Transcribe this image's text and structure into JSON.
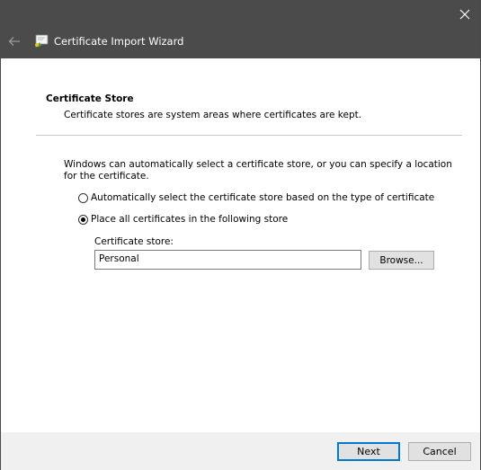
{
  "window": {
    "title": "Certificate Import Wizard"
  },
  "section": {
    "heading": "Certificate Store",
    "description": "Certificate stores are system areas where certificates are kept."
  },
  "content": {
    "intro": "Windows can automatically select a certificate store, or you can specify a location for the certificate.",
    "options": [
      {
        "label": "Automatically select the certificate store based on the type of certificate",
        "checked": false
      },
      {
        "label": "Place all certificates in the following store",
        "checked": true
      }
    ],
    "store_label": "Certificate store:",
    "store_value": "Personal",
    "browse_label": "Browse..."
  },
  "footer": {
    "next_label": "Next",
    "cancel_label": "Cancel"
  },
  "colors": {
    "titlebar": "#4b4b4b",
    "accent": "#0078d7",
    "footer": "#f0f0f0"
  }
}
